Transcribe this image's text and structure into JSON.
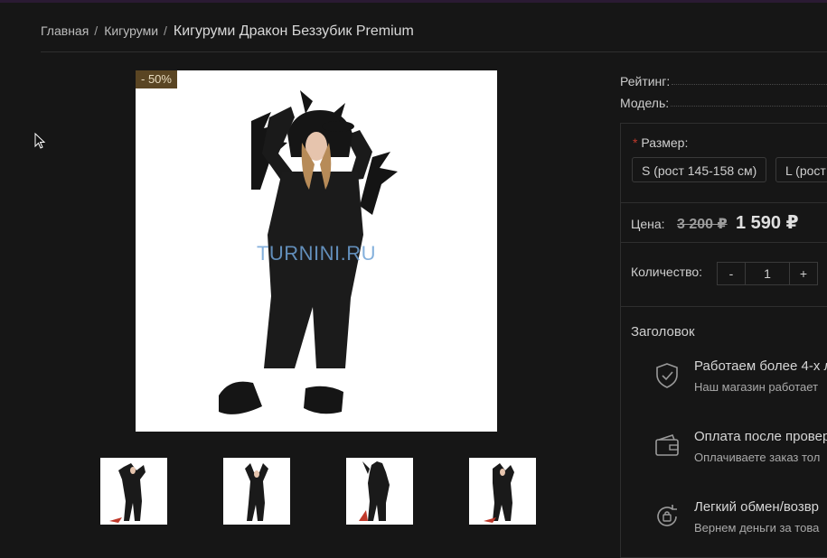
{
  "breadcrumb": {
    "home": "Главная",
    "category": "Кигуруми",
    "separator": "/",
    "current": "Кигуруми Дракон Беззубик Premium"
  },
  "product": {
    "discount_badge": "- 50%",
    "watermark": "TURNINI.RU",
    "thumbnails": [
      "thumbnail-1",
      "thumbnail-2",
      "thumbnail-3",
      "thumbnail-4"
    ]
  },
  "specs": {
    "rating_label": "Рейтинг:",
    "model_label": "Модель:"
  },
  "options": {
    "required_mark": "*",
    "size_label": "Размер:",
    "sizes": [
      "S (рост 145-158 см)",
      "L (рост"
    ]
  },
  "price": {
    "label": "Цена:",
    "old": "3 200 ₽",
    "new": "1 590 ₽"
  },
  "quantity": {
    "label": "Количество:",
    "minus": "-",
    "value": "1",
    "plus": "+"
  },
  "advantages": {
    "heading": "Заголовок",
    "items": [
      {
        "icon": "shield-check-icon",
        "title": "Работаем более 4-х л",
        "text": "Наш магазин работает"
      },
      {
        "icon": "wallet-icon",
        "title": "Оплата после провер",
        "text": "Оплачиваете заказ тол"
      },
      {
        "icon": "exchange-icon",
        "title": "Легкий обмен/возвр",
        "text": "Вернем деньги за това"
      }
    ]
  },
  "colors": {
    "background": "#161616",
    "badge": "#5a4523",
    "required": "#c0392b"
  }
}
